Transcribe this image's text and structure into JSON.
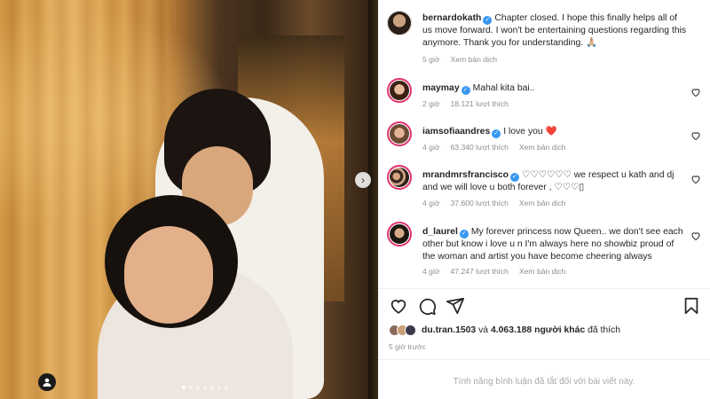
{
  "post": {
    "author": "bernardokath",
    "caption": "Chapter closed. I hope this finally helps all of us move forward. I won't be entertaining questions regarding this anymore. Thank you for understanding. 🙏🏼",
    "time": "5 giờ",
    "translate": "Xem bản dịch"
  },
  "comments": [
    {
      "user": "maymay",
      "text": "Mahal kita bai..",
      "time": "2 giờ",
      "likes": "18.121 lượt thích",
      "translate": ""
    },
    {
      "user": "iamsofiaandres",
      "text": "I love you ❤️",
      "time": "4 giờ",
      "likes": "63.340 lượt thích",
      "translate": "Xem bản dịch"
    },
    {
      "user": "mrandmrsfrancisco",
      "text": "♡♡♡♡♡♡ we respect u kath and dj and we will love u both forever , ♡♡♡▯",
      "time": "4 giờ",
      "likes": "37.600 lượt thích",
      "translate": "Xem bản dịch"
    },
    {
      "user": "d_laurel",
      "text": "My forever princess now Queen.. we don't see each other but know i love u n I'm always here no showbiz proud of the woman and artist you have become cheering always",
      "time": "4 giờ",
      "likes": "47.247 lượt thích",
      "translate": "Xem bản dịch"
    }
  ],
  "likes_line": {
    "first_user": "du.tran.1503",
    "conj": "và",
    "others": "4.063.188 người khác",
    "suffix": "đã thích"
  },
  "posted_ago": "5 giờ trước",
  "comments_disabled": "Tính năng bình luận đã tắt đối với bài viết này.",
  "icons": [
    "next-arrow-icon",
    "user-tag-icon",
    "heart-icon",
    "comment-icon",
    "share-icon",
    "bookmark-icon",
    "verified-icon"
  ],
  "colors": {
    "verified": "#3897f0",
    "story_ring": "#e1306c",
    "muted": "#8e8e8e"
  }
}
